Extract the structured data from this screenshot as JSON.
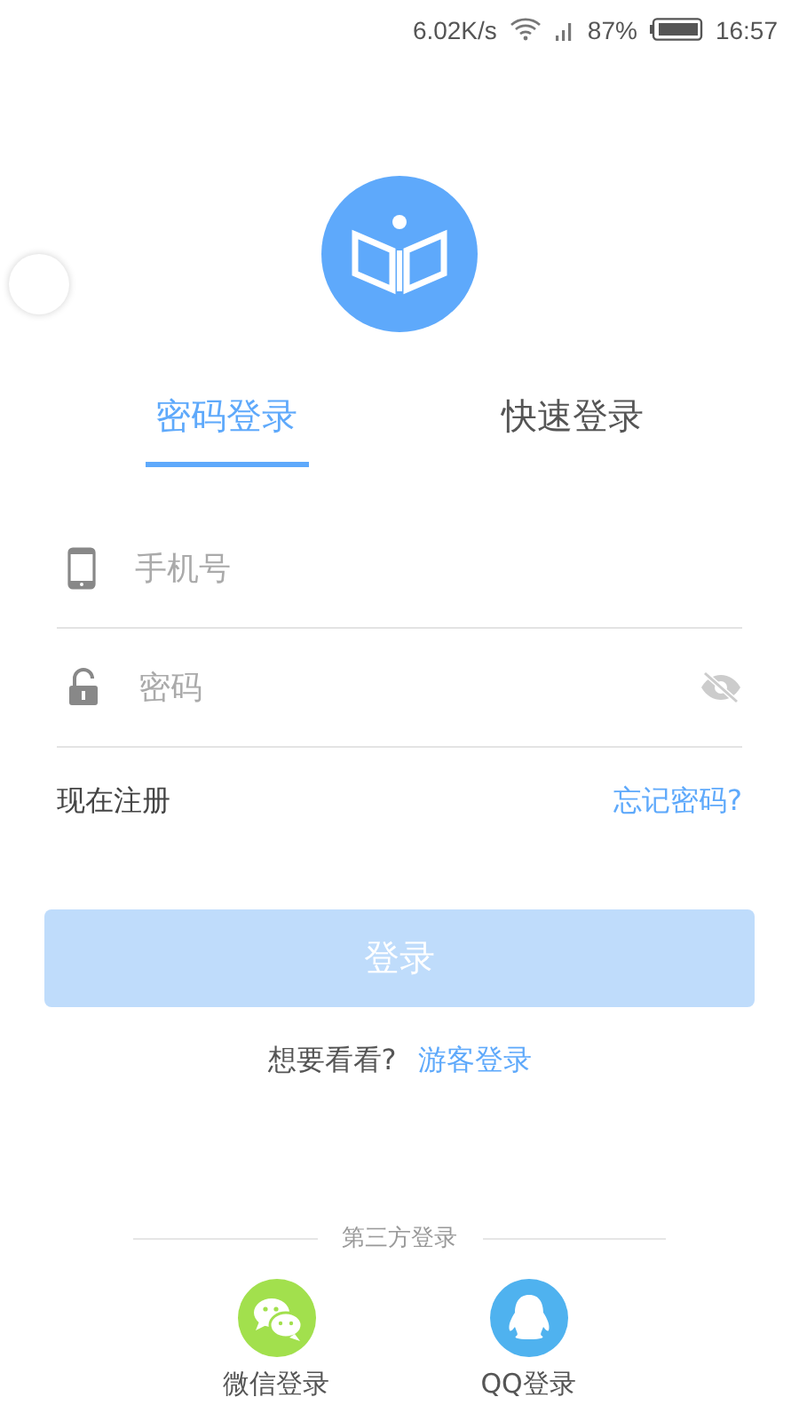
{
  "status_bar": {
    "speed": "6.02K/s",
    "battery": "87%",
    "time": "16:57"
  },
  "tabs": [
    {
      "label": "密码登录",
      "selected": true
    },
    {
      "label": "快速登录",
      "selected": false
    }
  ],
  "fields": [
    {
      "kind": "phone",
      "placeholder": "手机号"
    },
    {
      "kind": "password",
      "placeholder": "密码"
    }
  ],
  "register_link": "现在注册",
  "forgot_link": "忘记密码?",
  "login_button": {
    "label": "登录",
    "disabled": true
  },
  "guest": {
    "prompt": "想要看看?",
    "link": "游客登录"
  },
  "third_party": {
    "title": "第三方登录",
    "options": [
      {
        "kind": "wechat",
        "label": "微信登录"
      },
      {
        "kind": "qq",
        "label": "QQ登录"
      }
    ]
  }
}
